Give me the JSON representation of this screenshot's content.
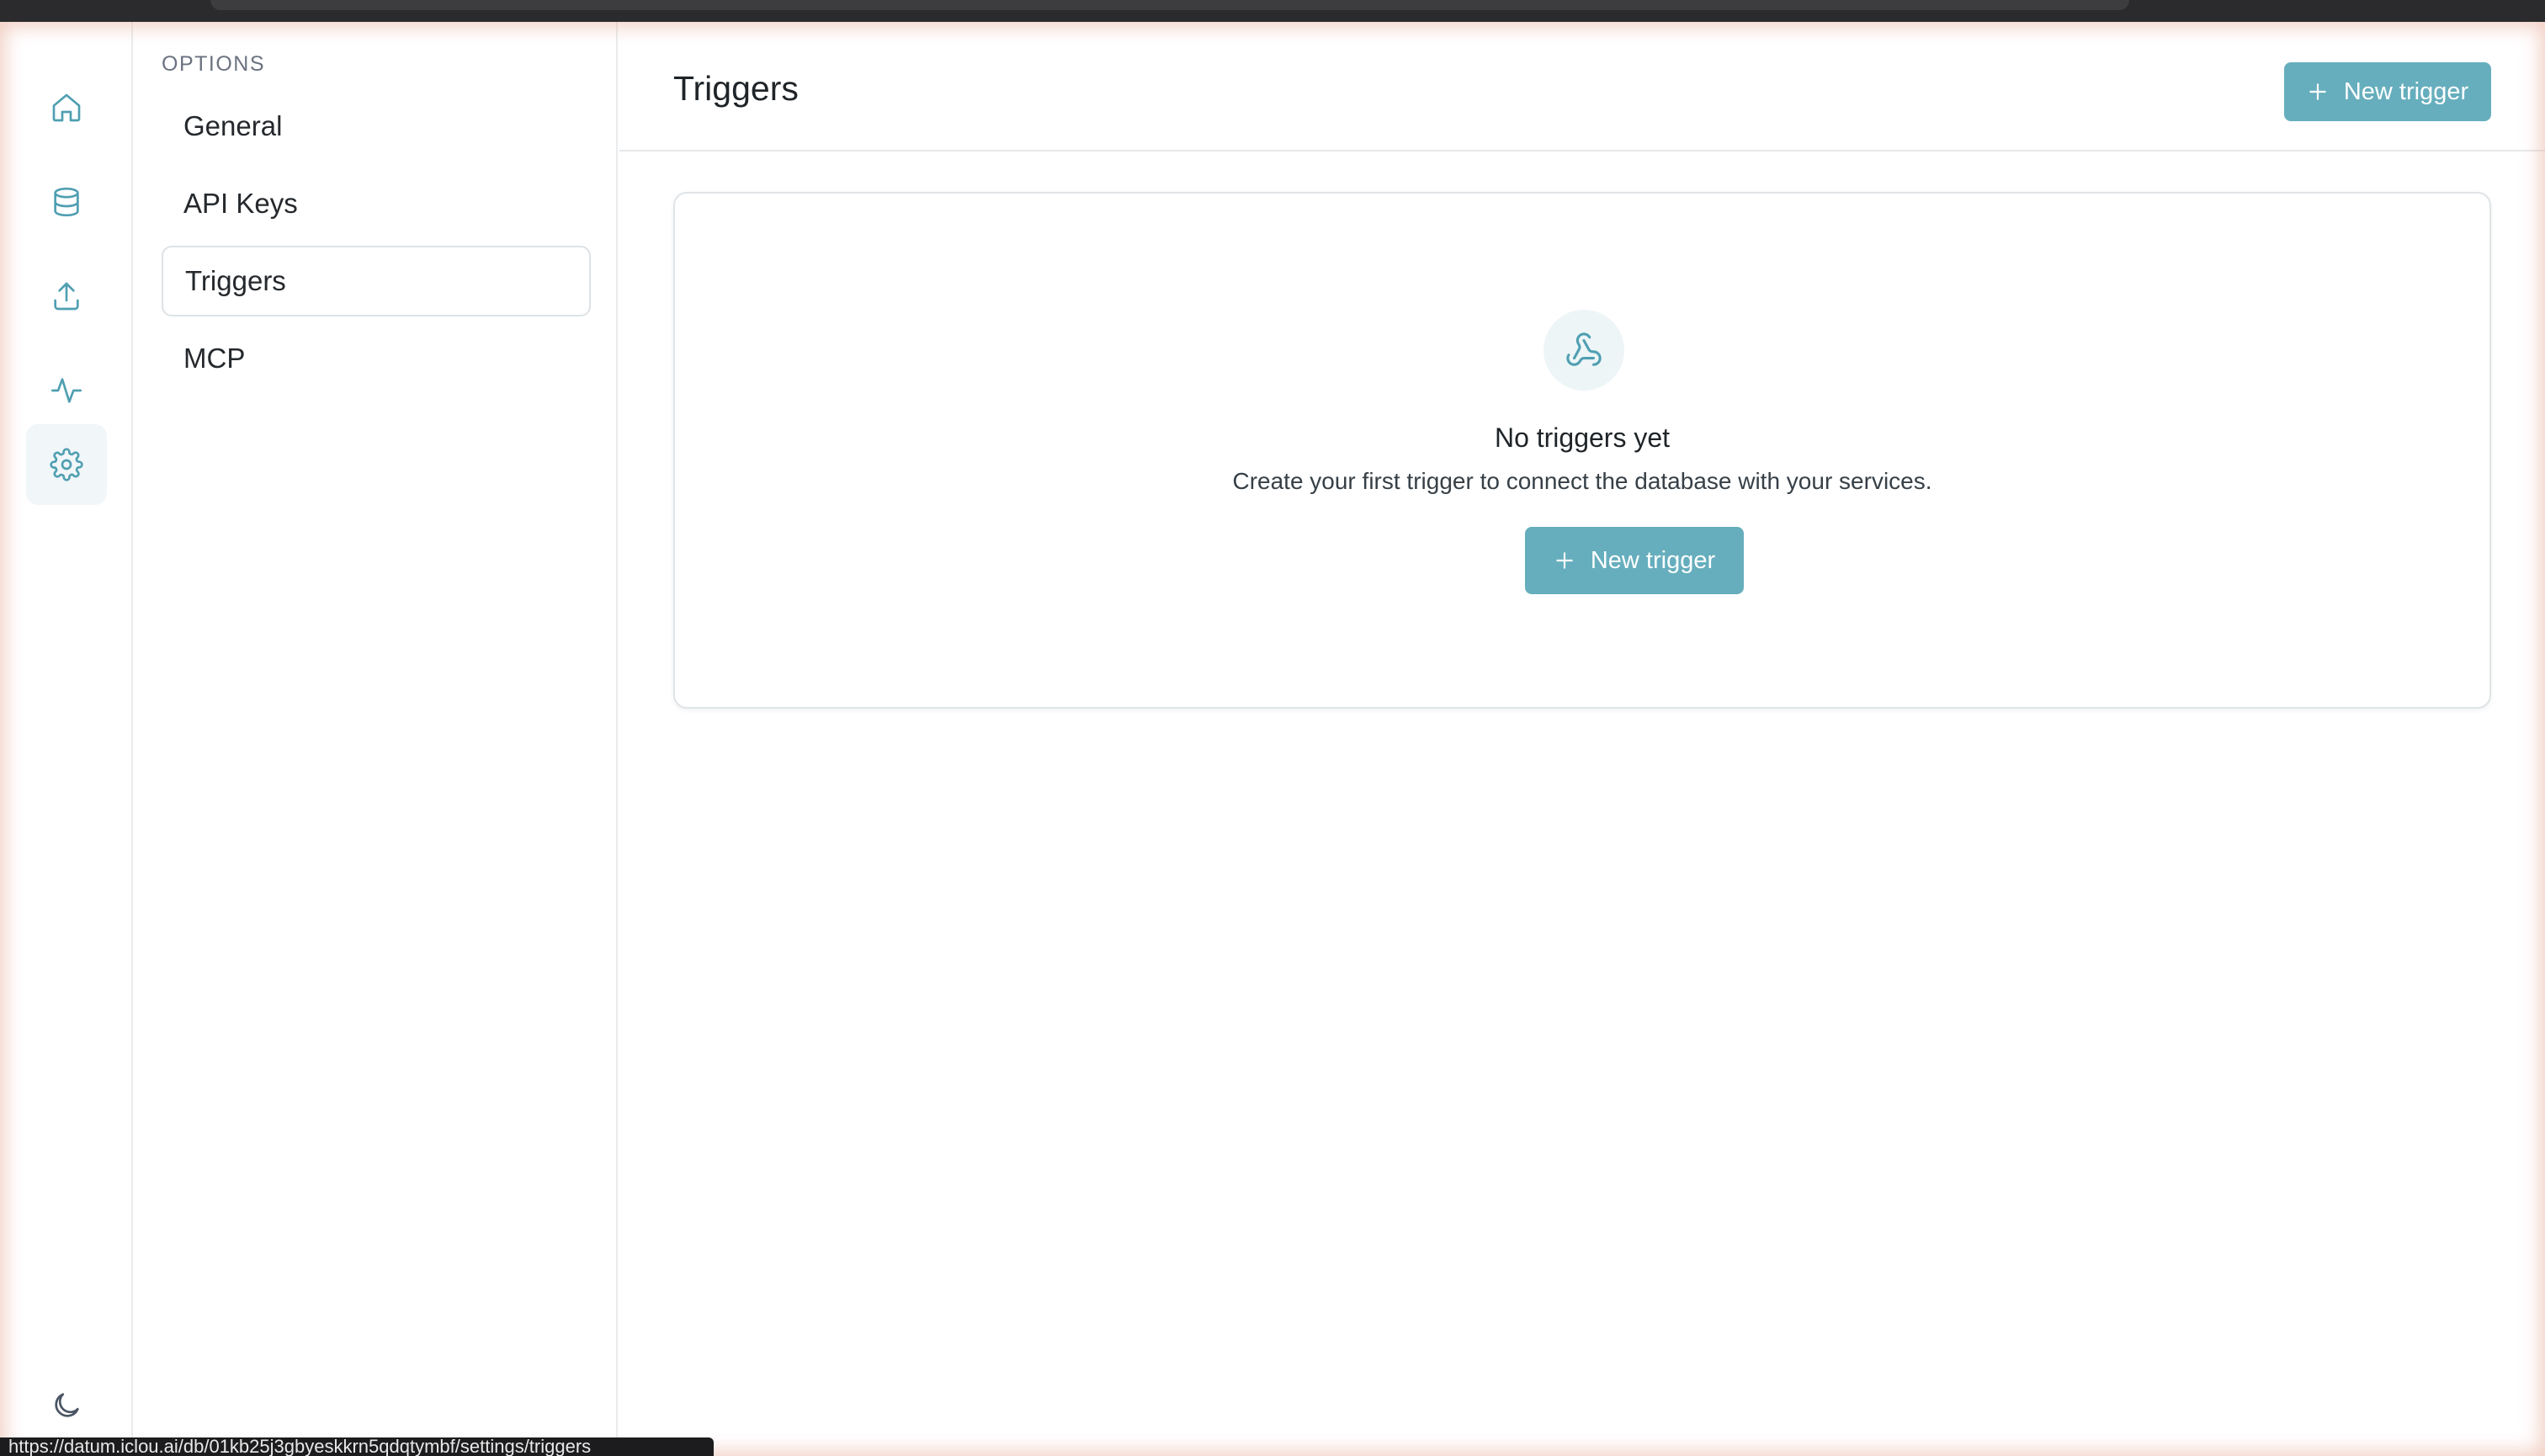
{
  "rail": {
    "items": [
      {
        "name": "home",
        "icon": "home-icon",
        "active": false
      },
      {
        "name": "database",
        "icon": "database-icon",
        "active": false
      },
      {
        "name": "upload",
        "icon": "upload-icon",
        "active": false
      },
      {
        "name": "activity",
        "icon": "activity-icon",
        "active": false
      },
      {
        "name": "settings",
        "icon": "gear-icon",
        "active": true
      }
    ],
    "theme_toggle_icon": "moon-icon"
  },
  "options": {
    "title": "OPTIONS",
    "items": [
      {
        "label": "General",
        "active": false
      },
      {
        "label": "API Keys",
        "active": false
      },
      {
        "label": "Triggers",
        "active": true
      },
      {
        "label": "MCP",
        "active": false
      }
    ]
  },
  "main": {
    "title": "Triggers",
    "new_trigger_label": "New trigger",
    "empty": {
      "icon": "webhook-icon",
      "title": "No triggers yet",
      "description": "Create your first trigger to connect the database with your services.",
      "button_label": "New trigger"
    }
  },
  "status_url": "https://datum.iclou.ai/db/01kb25j3gbyeskkrn5qdqtymbf/settings/triggers",
  "colors": {
    "accent": "#66aebd",
    "icon": "#4f9fb1",
    "active_bg": "#f1f6f8"
  }
}
